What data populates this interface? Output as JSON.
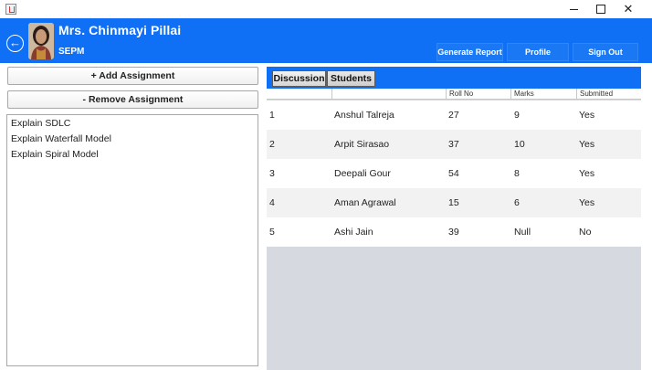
{
  "window": {
    "icon": "java-app-icon",
    "controls": [
      "minimize-icon",
      "maximize-icon",
      "close-icon"
    ],
    "close_glyph": "✕"
  },
  "header": {
    "teacher_name": "Mrs. Chinmayi Pillai",
    "subject": "SEPM",
    "back_glyph": "←",
    "buttons": {
      "generate_report": "Generate Report",
      "profile": "Profile",
      "sign_out": "Sign Out"
    },
    "colors": {
      "bar": "#0f6ff5",
      "button": "#1a78f5"
    }
  },
  "assignments": {
    "add_label": "+ Add Assignment",
    "remove_label": "-  Remove Assignment",
    "items": [
      "Explain SDLC",
      "Explain Waterfall Model",
      "Explain Spiral Model"
    ]
  },
  "tabs": [
    {
      "label": "Discussion",
      "selected": false
    },
    {
      "label": "Students",
      "selected": true
    }
  ],
  "students_table": {
    "columns": [
      "",
      "",
      "Roll No",
      "Marks",
      "Submitted"
    ],
    "rows": [
      [
        "1",
        "Anshul Talreja",
        "27",
        "9",
        "Yes"
      ],
      [
        "2",
        "Arpit Sirasao",
        "37",
        "10",
        "Yes"
      ],
      [
        "3",
        "Deepali Gour",
        "54",
        "8",
        "Yes"
      ],
      [
        "4",
        "Aman Agrawal",
        "15",
        "6",
        "Yes"
      ],
      [
        "5",
        "Ashi Jain",
        "39",
        "Null",
        "No"
      ]
    ]
  }
}
